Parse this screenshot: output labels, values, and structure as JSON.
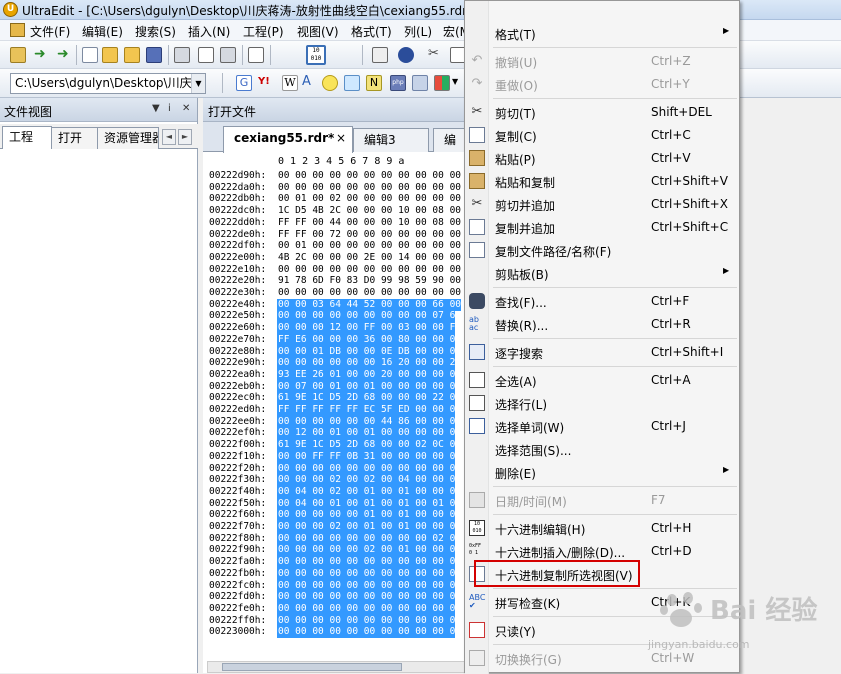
{
  "window": {
    "title": "UltraEdit - [C:\\Users\\dgulyn\\Desktop\\川庆蒋涛-放射性曲线空白\\cexiang55.rdr*"
  },
  "menubar": [
    "文件(F)",
    "编辑(E)",
    "搜索(S)",
    "插入(N)",
    "工程(P)",
    "视图(V)",
    "格式(T)",
    "列(L)",
    "宏(M"
  ],
  "toolbar": {
    "path_combo": "C:\\Users\\dgulyn\\Desktop\\川庆"
  },
  "left_panel": {
    "title": "文件视图",
    "pin_icon": "pin-icon",
    "close_icon": "close-icon",
    "tabs": [
      "工程",
      "打开",
      "资源管理器"
    ]
  },
  "right_panel": {
    "title": "打开文件",
    "doc_tabs": [
      {
        "label": "cexiang55.rdr*",
        "active": true,
        "close": "×"
      },
      {
        "label": "编辑3",
        "active": false
      },
      {
        "label": "编",
        "active": false
      }
    ]
  },
  "hex": {
    "column_header": "0 1 2 3 4 5 6 7 8 9 a",
    "rows": [
      {
        "offset": "00222d90h:",
        "data": "00 00 00 00 00 00 00 00 00 00 00",
        "sel": false
      },
      {
        "offset": "00222da0h:",
        "data": "00 00 00 00 00 00 00 00 00 00 00",
        "sel": false
      },
      {
        "offset": "00222db0h:",
        "data": "00 01 00 02 00 00 00 00 00 00 00",
        "sel": false
      },
      {
        "offset": "00222dc0h:",
        "data": "1C D5 4B 2C 00 00 00 10 00 08 00",
        "sel": false
      },
      {
        "offset": "00222dd0h:",
        "data": "FF FF 00 44 00 00 00 10 00 08 00",
        "sel": false
      },
      {
        "offset": "00222de0h:",
        "data": "FF FF 00 72 00 00 00 00 00 00 00",
        "sel": false
      },
      {
        "offset": "00222df0h:",
        "data": "00 01 00 00 00 00 00 00 00 00 00",
        "sel": false
      },
      {
        "offset": "00222e00h:",
        "data": "4B 2C 00 00 00 2E 00 14 00 00 00",
        "sel": false
      },
      {
        "offset": "00222e10h:",
        "data": "00 00 00 00 00 00 00 00 00 00 00",
        "sel": false
      },
      {
        "offset": "00222e20h:",
        "data": "91 78 6D F0 83 D0 99 98 59 90 00",
        "sel": false
      },
      {
        "offset": "00222e30h:",
        "data": "00 00 00 00 00 00 00 00 00 00 00",
        "sel": false
      },
      {
        "offset": "00222e40h:",
        "data": "00 00 03 64 44 52 00 00 00 66 00",
        "sel": true
      },
      {
        "offset": "00222e50h:",
        "data": "00 00 00 00 00 00 00 00 00 07 6",
        "sel": true
      },
      {
        "offset": "00222e60h:",
        "data": "00 00 00 12 00 FF 00 03 00 00 F",
        "sel": true
      },
      {
        "offset": "00222e70h:",
        "data": "FF E6 00 00 00 36 00 80 00 00 0",
        "sel": true
      },
      {
        "offset": "00222e80h:",
        "data": "00 00 01 DB 00 00 0E DB 00 00 0",
        "sel": true
      },
      {
        "offset": "00222e90h:",
        "data": "00 00 00 00 00 00 16 20 00 00 2",
        "sel": true
      },
      {
        "offset": "00222ea0h:",
        "data": "93 EE 26 01 00 00 20 00 00 00 0",
        "sel": true
      },
      {
        "offset": "00222eb0h:",
        "data": "00 07 00 01 00 01 00 00 00 00 0",
        "sel": true
      },
      {
        "offset": "00222ec0h:",
        "data": "61 9E 1C D5 2D 68 00 00 00 22 0",
        "sel": true
      },
      {
        "offset": "00222ed0h:",
        "data": "FF FF FF FF FF EC 5F ED 00 00 0",
        "sel": true
      },
      {
        "offset": "00222ee0h:",
        "data": "00 00 00 00 00 00 44 86 00 00 0",
        "sel": true
      },
      {
        "offset": "00222ef0h:",
        "data": "00 12 00 01 00 01 00 00 00 00 0",
        "sel": true
      },
      {
        "offset": "00222f00h:",
        "data": "61 9E 1C D5 2D 68 00 00 02 0C 0",
        "sel": true
      },
      {
        "offset": "00222f10h:",
        "data": "00 00 FF FF 0B 31 00 00 00 00 0",
        "sel": true
      },
      {
        "offset": "00222f20h:",
        "data": "00 00 00 00 00 00 00 00 00 00 0",
        "sel": true
      },
      {
        "offset": "00222f30h:",
        "data": "00 00 00 02 00 02 00 04 00 00 0",
        "sel": true
      },
      {
        "offset": "00222f40h:",
        "data": "00 04 00 02 00 01 00 01 00 00 0",
        "sel": true
      },
      {
        "offset": "00222f50h:",
        "data": "00 04 00 01 00 01 00 01 00 01 0",
        "sel": true
      },
      {
        "offset": "00222f60h:",
        "data": "00 00 00 00 00 01 00 01 00 00 0",
        "sel": true
      },
      {
        "offset": "00222f70h:",
        "data": "00 00 00 02 00 01 00 01 00 00 0",
        "sel": true
      },
      {
        "offset": "00222f80h:",
        "data": "00 00 00 00 00 00 00 00 00 02 0",
        "sel": true
      },
      {
        "offset": "00222f90h:",
        "data": "00 00 00 00 00 02 00 01 00 00 0",
        "sel": true
      },
      {
        "offset": "00222fa0h:",
        "data": "00 00 00 00 00 00 00 00 00 00 0",
        "sel": true
      },
      {
        "offset": "00222fb0h:",
        "data": "00 00 00 00 00 00 00 00 00 00 0",
        "sel": true
      },
      {
        "offset": "00222fc0h:",
        "data": "00 00 00 00 00 00 00 00 00 00 0",
        "sel": true
      },
      {
        "offset": "00222fd0h:",
        "data": "00 00 00 00 00 00 00 00 00 00 0",
        "sel": true
      },
      {
        "offset": "00222fe0h:",
        "data": "00 00 00 00 00 00 00 00 00 00 0",
        "sel": true
      },
      {
        "offset": "00222ff0h:",
        "data": "00 00 00 00 00 00 00 00 00 00 0",
        "sel": true
      },
      {
        "offset": "00223000h:",
        "data": "00 00 00 00 00 00 00 00 00 00 0",
        "sel": true
      }
    ]
  },
  "context_menu": {
    "items": [
      {
        "label": "格式(T)",
        "shortcut": "",
        "submenu": true,
        "disabled": false,
        "icon": "",
        "sep_after": true
      },
      {
        "label": "撤销(U)",
        "shortcut": "Ctrl+Z",
        "submenu": false,
        "disabled": true,
        "icon": "undo-icon",
        "sep_after": false
      },
      {
        "label": "重做(O)",
        "shortcut": "Ctrl+Y",
        "submenu": false,
        "disabled": true,
        "icon": "redo-icon",
        "sep_after": true
      },
      {
        "label": "剪切(T)",
        "shortcut": "Shift+DEL",
        "submenu": false,
        "disabled": false,
        "icon": "cut-icon",
        "sep_after": false
      },
      {
        "label": "复制(C)",
        "shortcut": "Ctrl+C",
        "submenu": false,
        "disabled": false,
        "icon": "copy-icon",
        "sep_after": false
      },
      {
        "label": "粘贴(P)",
        "shortcut": "Ctrl+V",
        "submenu": false,
        "disabled": false,
        "icon": "paste-icon",
        "sep_after": false
      },
      {
        "label": "粘贴和复制",
        "shortcut": "Ctrl+Shift+V",
        "submenu": false,
        "disabled": false,
        "icon": "paste-copy-icon",
        "sep_after": false
      },
      {
        "label": "剪切并追加",
        "shortcut": "Ctrl+Shift+X",
        "submenu": false,
        "disabled": false,
        "icon": "cut-append-icon",
        "sep_after": false
      },
      {
        "label": "复制并追加",
        "shortcut": "Ctrl+Shift+C",
        "submenu": false,
        "disabled": false,
        "icon": "copy-append-icon",
        "sep_after": false
      },
      {
        "label": "复制文件路径/名称(F)",
        "shortcut": "",
        "submenu": false,
        "disabled": false,
        "icon": "copy-path-icon",
        "sep_after": false
      },
      {
        "label": "剪贴板(B)",
        "shortcut": "",
        "submenu": true,
        "disabled": false,
        "icon": "",
        "sep_after": true
      },
      {
        "label": "查找(F)...",
        "shortcut": "Ctrl+F",
        "submenu": false,
        "disabled": false,
        "icon": "binoculars-icon",
        "sep_after": false
      },
      {
        "label": "替换(R)...",
        "shortcut": "Ctrl+R",
        "submenu": false,
        "disabled": false,
        "icon": "replace-icon",
        "sep_after": true
      },
      {
        "label": "逐字搜索",
        "shortcut": "Ctrl+Shift+I",
        "submenu": false,
        "disabled": false,
        "icon": "incremental-search-icon",
        "sep_after": true
      },
      {
        "label": "全选(A)",
        "shortcut": "Ctrl+A",
        "submenu": false,
        "disabled": false,
        "icon": "select-all-icon",
        "sep_after": false
      },
      {
        "label": "选择行(L)",
        "shortcut": "",
        "submenu": false,
        "disabled": false,
        "icon": "select-line-icon",
        "sep_after": false
      },
      {
        "label": "选择单词(W)",
        "shortcut": "Ctrl+J",
        "submenu": false,
        "disabled": false,
        "icon": "select-word-icon",
        "sep_after": false
      },
      {
        "label": "选择范围(S)...",
        "shortcut": "",
        "submenu": false,
        "disabled": false,
        "icon": "",
        "sep_after": false
      },
      {
        "label": "删除(E)",
        "shortcut": "",
        "submenu": true,
        "disabled": false,
        "icon": "",
        "sep_after": true
      },
      {
        "label": "日期/时间(M)",
        "shortcut": "F7",
        "submenu": false,
        "disabled": true,
        "icon": "datetime-icon",
        "sep_after": true
      },
      {
        "label": "十六进制编辑(H)",
        "shortcut": "Ctrl+H",
        "submenu": false,
        "disabled": false,
        "icon": "hex-edit-icon",
        "sep_after": false
      },
      {
        "label": "十六进制插入/删除(D)...",
        "shortcut": "Ctrl+D",
        "submenu": false,
        "disabled": false,
        "icon": "hex-insert-icon",
        "sep_after": false
      },
      {
        "label": "十六进制复制所选视图(V)",
        "shortcut": "",
        "submenu": false,
        "disabled": false,
        "icon": "hex-copy-view-icon",
        "sep_after": true
      },
      {
        "label": "拼写检查(K)",
        "shortcut": "Ctrl+K",
        "submenu": false,
        "disabled": false,
        "icon": "spellcheck-icon",
        "sep_after": true
      },
      {
        "label": "只读(Y)",
        "shortcut": "",
        "submenu": false,
        "disabled": false,
        "icon": "readonly-icon",
        "sep_after": true
      },
      {
        "label": "切换换行(G)",
        "shortcut": "Ctrl+W",
        "submenu": false,
        "disabled": true,
        "icon": "wordwrap-icon",
        "sep_after": false
      }
    ]
  },
  "watermark": {
    "brand": "Bai 经验",
    "url": "jingyan.baidu.com"
  },
  "colors": {
    "selection": "#3399ff",
    "highlight_box": "#d40000",
    "menu_bg": "#f5f5f5"
  }
}
